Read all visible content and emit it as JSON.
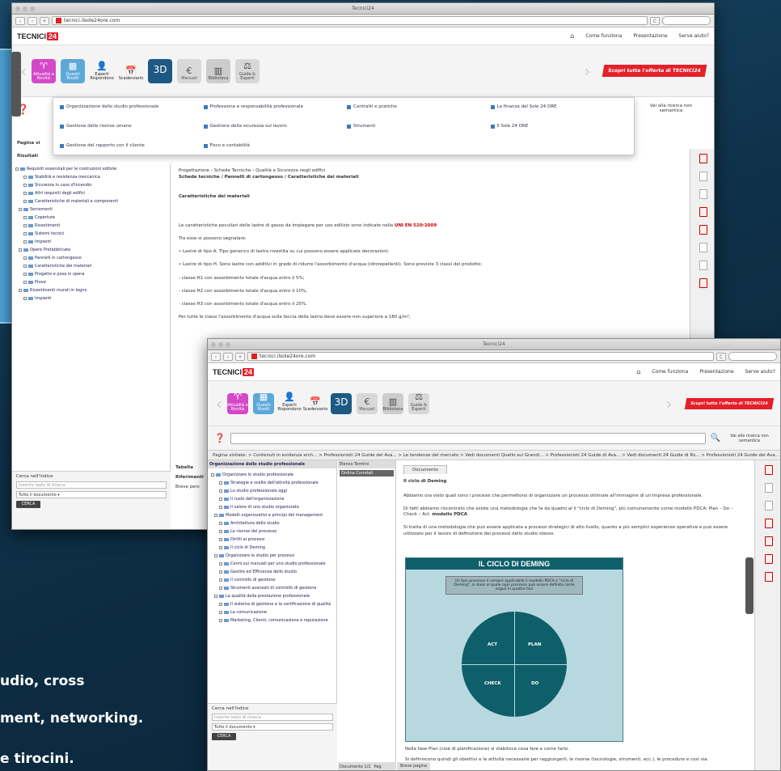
{
  "caption": {
    "line1": "udio, cross",
    "line2": "ment, networking.",
    "line3": "e tirocini."
  },
  "common": {
    "logo_text": "TECNICI",
    "logo_badge": "24",
    "header_links": [
      "Come funziona",
      "Presentazione",
      "Serve aiuto?"
    ],
    "tiles": [
      {
        "label": "Attualità e Novità",
        "glyph": "♈"
      },
      {
        "label": "Quesiti Risolti",
        "glyph": "▦"
      },
      {
        "label": "Esperti Rispondono",
        "glyph": "👤"
      },
      {
        "label": "Scadenzario",
        "glyph": "📅"
      },
      {
        "label": "",
        "glyph": "3D"
      },
      {
        "label": "Manuali",
        "glyph": "€"
      },
      {
        "label": "Biblioteca",
        "glyph": "▥"
      },
      {
        "label": "Guide & Esperti",
        "glyph": "⚖"
      }
    ],
    "promo": "Scopri tutta l'offerta di TECNICI24",
    "semantic_search": "Vai alla ricerca non semantica"
  },
  "win1": {
    "title": "Tecnici24",
    "url": "tecnici.ilsole24ore.com",
    "dropdown": [
      "Organizzazione dello studio professionale",
      "Professione e responsabilità professionale",
      "Contratti e pratiche",
      "La finanza del Sole 24 ORE",
      "Gestione delle risorse umane",
      "Gestione della sicurezza sul lavoro",
      "Strumenti",
      "Il Sole 24 ORE",
      "Gestione del rapporto con il cliente",
      "Fisco e contabilità"
    ],
    "path_label": "Pagina vi",
    "results_label": "Risultati",
    "tree": [
      "Requisiti essenziali per le costruzioni edilizie",
      "Stabilità e resistenza meccanica",
      "Sicurezza in caso d'incendio",
      "Altri requisiti degli edifici",
      "Caratteristiche di materiali e componenti",
      "Serramenti",
      "Coperture",
      "Rivestimenti",
      "Sistemi tecnici",
      "Impianti",
      "Opere Prefabbricate",
      "Pannelli in cartongesso",
      "Caratteristiche dei materiali",
      "Progetto e posa in opera",
      "Prove",
      "Rivestimenti murali in legno",
      "Impianti"
    ],
    "breadcrumb": "Progettazione › Schede Tecniche › Qualità e Sicurezza negli edifici",
    "doc_title": "Schede tecniche / Pannelli di cartongesso / Caratteristiche dei materiali",
    "section": "Caratteristiche dei materiali",
    "paragraphs": [
      "Le caratteristiche peculiari delle lastre di gesso da impiegare per uso edilizio sono indicate nella",
      "Tra esse si possono segnalare:",
      "• Lastre di tipo A. Tipo generico di lastra rivestita su cui possono essere applicate decorazioni;",
      "• Lastre di tipo H. Sono lastre con additivi in grado di ridurre l'assorbimento d'acqua (idrorepellenti). Sono previste 3 classi del prodotto:",
      "- classe H1 con assorbimento totale d'acqua entro il 5%;",
      "- classe H2 con assorbimento totale d'acqua entro il 10%;",
      "- classe H3 con assorbimento totale d'acqua entro il 25%.",
      "Per tutte le classi l'assorbimento d'acqua sulla faccia della lastra deve essere non superiore a 180 g/m²;"
    ],
    "norm": "UNI EN 520:2009",
    "filter_label": "Cerca nell'Indice",
    "filter_placeholder": "Inserire testo di ricerca",
    "filter_select": "Tutto il documento",
    "go": "CERCA",
    "notes": [
      "Tabella",
      "Riferimenti",
      "Breve pers"
    ]
  },
  "win2": {
    "title": "Tecnici24",
    "url": "tecnici.ilsole24ore.com",
    "path": "Pagina visitate: > Contenuti in evidenza arch... > Professionisti 24 Guide del Ava... > Le tendenze del mercato > Vedi documenti Quello sui Grandi... > Professionisti 24 Guide di Ava... > Vedi documenti 24 Guide di Rx... > Professionisti 24 Guide del Ava...",
    "tree_title": "Organizzazione dello studio professionale",
    "tree": [
      "Organizzare lo studio professionale",
      "Strategie e scelte dell'attività professionale",
      "Lo studio professionale oggi",
      "Il ruolo dell'organizzazione",
      "Il valore di uno studio organizzato",
      "Modelli organizzativi e principi del management",
      "Architettura dello studio",
      "Le risorse del processo",
      "Diritti ai processi",
      "Il ciclo di Deming",
      "Organizzare lo studio per processi",
      "Cenni sui manuali per uno studio professionale",
      "Gestire ed Efficienza dello studio",
      "Il controllo di gestione",
      "Strumenti avanzati di controllo di gestione",
      "La qualità della prestazione professionale",
      "Il sistema di gestione e la certificazione di qualità",
      "La comunicazione",
      "Marketing, Clienti, comunicazione e reputazione"
    ],
    "mid_tabs": [
      "Elenco Termini",
      "Ordina Correlati"
    ],
    "doc_tab": "Documento",
    "doc_title": "Il ciclo di Deming",
    "paragraphs": [
      "Abbiamo ora visto quali sono i processi che permettono di organizzare un processo ottimale all'immagine di un'impresa professionale.",
      "Di fatti abbiamo riscontrato che esiste una metodologia che fa da quadro al il \"ciclo di Deming\", più comunemente come modello PDCA: Plan – Do – Check – Act.",
      "Si tratta di una metodologia che può essere applicata a processi strategici di alto livello, quanto a più semplici esperienze operative e può essere utilizzato per il lavoro di definizione dei processi dello studio stesso."
    ],
    "pdca_bold": "modello PDCA",
    "diagram_title": "IL CICLO DI DEMING",
    "diagram_note": "Un tipo processo è sempre applicabile il modello PDCA o \"ciclo di Deming\", in base al quale ogni processo può essere definito come segue in quattro fasi",
    "quadrants": [
      "ACT",
      "PLAN",
      "CHECK",
      "DO"
    ],
    "after": [
      "Nella fase Plan (cioè di pianificazione) si stabilisce cosa fare e come farlo.",
      "Si definiscono quindi gli obiettivi e le attività necessarie per raggiungerli, le risorse (tecnologie, strumenti, ecc.), le procedure e così via."
    ],
    "bottom_tabs": [
      "Documento 1/1",
      "Pag",
      "Breve pagina"
    ],
    "filter_label": "Cerca nell'Indice",
    "filter_placeholder": "Inserire testo di ricerca",
    "filter_select": "Tutto il documento",
    "go": "CERCA"
  }
}
